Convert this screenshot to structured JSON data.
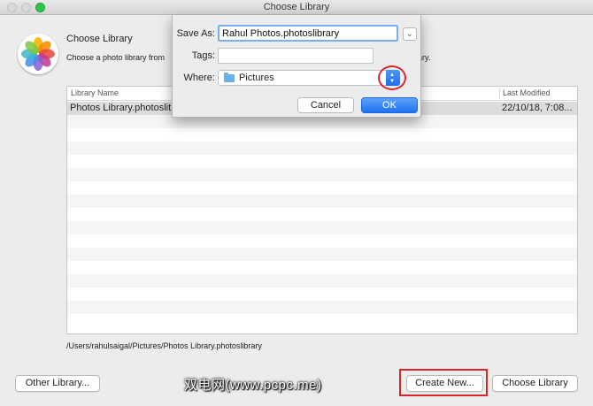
{
  "window": {
    "title": "Choose Library"
  },
  "header": {
    "heading": "Choose Library",
    "description_left": "Choose a photo library from",
    "description_right": "ary."
  },
  "table": {
    "columns": [
      "Library Name",
      "Last Modified"
    ],
    "rows": [
      {
        "name": "Photos Library.photoslit",
        "modified": "22/10/18, 7:08..."
      }
    ],
    "empty_rows": 15
  },
  "selected_path": "/Users/rahulsaigal/Pictures/Photos Library.photoslibrary",
  "buttons": {
    "other_library": "Other Library...",
    "create_new": "Create New...",
    "choose_library": "Choose Library"
  },
  "watermark": "双电网(www.pcpc.me)",
  "save_sheet": {
    "save_as_label": "Save As:",
    "save_as_value": "Rahul Photos.photoslibrary",
    "tags_label": "Tags:",
    "tags_value": "",
    "where_label": "Where:",
    "where_value": "Pictures",
    "cancel_label": "Cancel",
    "ok_label": "OK"
  },
  "icons": {
    "app_icon": "photos-app-icon",
    "where_icon": "folder-icon",
    "expand_icon": "chevron-down-icon",
    "stepper_icon": "updown-arrows-icon"
  },
  "colors": {
    "accent": "#1e72ef",
    "annotation": "#d9262a",
    "window_bg": "#ececec"
  }
}
